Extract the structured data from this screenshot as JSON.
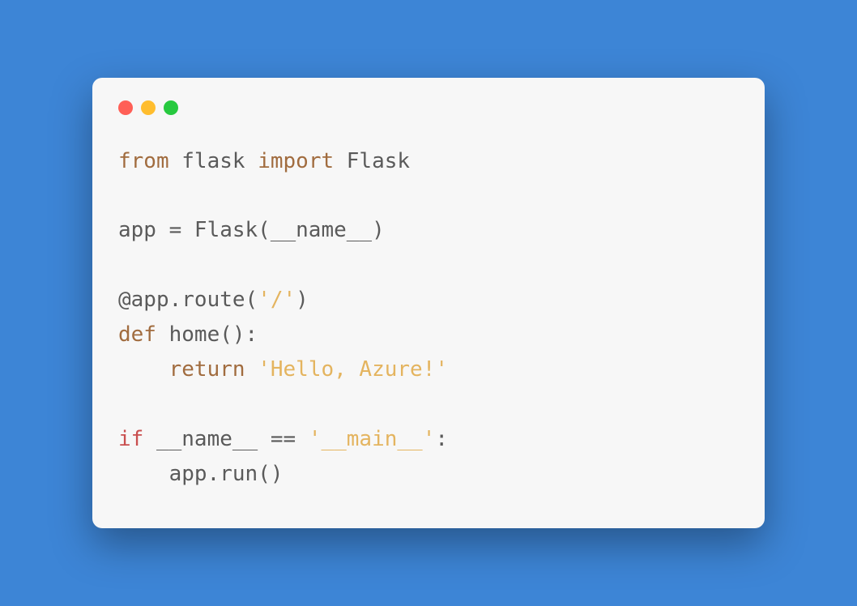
{
  "window": {
    "buttons": [
      "close",
      "minimize",
      "maximize"
    ]
  },
  "code": {
    "line1": {
      "kw_from": "from",
      "mod": " flask ",
      "kw_import": "import",
      "name": " Flask"
    },
    "line2": "",
    "line3": {
      "lhs": "app = Flask(__name__)"
    },
    "line4": "",
    "line5": {
      "decor_at": "@app",
      "decor_rest": ".route(",
      "route_str": "'/'",
      "close": ")"
    },
    "line6": {
      "kw_def": "def",
      "fn": " home():"
    },
    "line7": {
      "indent": "    ",
      "kw_return": "return",
      "sp": " ",
      "str": "'Hello, Azure!'"
    },
    "line8": "",
    "line9": {
      "kw_if": "if",
      "mid": " __name__ == ",
      "str": "'__main__'",
      "colon": ":"
    },
    "line10": {
      "indent": "    ",
      "call": "app.run()"
    }
  }
}
